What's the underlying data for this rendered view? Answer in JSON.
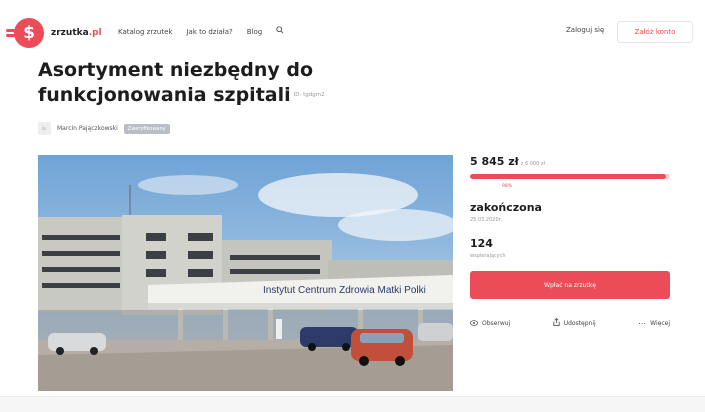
{
  "header": {
    "logo_mark": "$",
    "logo_name": "zrzutka",
    "logo_tld": ".pl",
    "nav": [
      "Katalog zrzutek",
      "Jak to działa?",
      "Blog"
    ],
    "search_icon": "search-icon",
    "login_label": "Zaloguj się",
    "register_label": "Załóż konto"
  },
  "campaign": {
    "title": "Asortyment niezbędny do funkcjonowania szpitali",
    "ref": "ID: tgdgm2",
    "author_avatar": "ikr",
    "author_name": "Marcin Pajączkowski",
    "author_badge": "Zweryfikowany",
    "photo_sign": "Instytut Centrum Zdrowia Matki Polki"
  },
  "stats": {
    "amount": "5 845 zł",
    "goal": "z 6 000 zł",
    "progress_percent": 98,
    "percent_label": "98%",
    "status": "zakończona",
    "date": "25.03.2020r.",
    "supporters": "124",
    "supporters_label": "wspierających"
  },
  "actions": {
    "support_label": "Wpłać na zrzutkę",
    "observe_icon": "eye-icon",
    "observe_label": "Obserwuj",
    "share_icon": "share-icon",
    "share_label": "Udostępnij",
    "more_icon": "more-icon",
    "more_label": "Więcej"
  },
  "colors": {
    "brand": "#ec4c58",
    "progress_bg": "#f3d2d6"
  }
}
